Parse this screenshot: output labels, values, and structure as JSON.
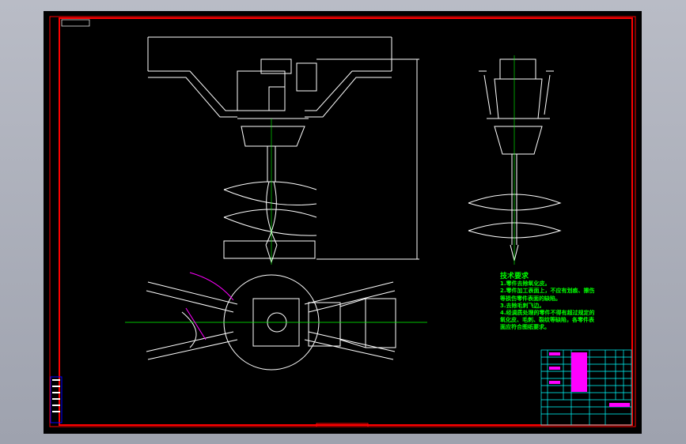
{
  "drawing": {
    "background": "#000000",
    "frame_color": "#ff0000",
    "line_color": "#ffffff",
    "centerline_color": "#00ff00",
    "leader_color": "#ff00ff",
    "table_color": "#00ffff"
  },
  "tech_requirements": {
    "title": "技术要求",
    "items": [
      "1.零件去除氧化皮。",
      "2.零件加工表面上，不应有划痕、擦伤等损伤零件表面的缺陷。",
      "3.去除毛刺飞边。",
      "4.经调质处理的零件不得有超过规定的氧化皮、毛刺、裂纹等缺陷，各零件表面应符合图纸要求。"
    ]
  }
}
